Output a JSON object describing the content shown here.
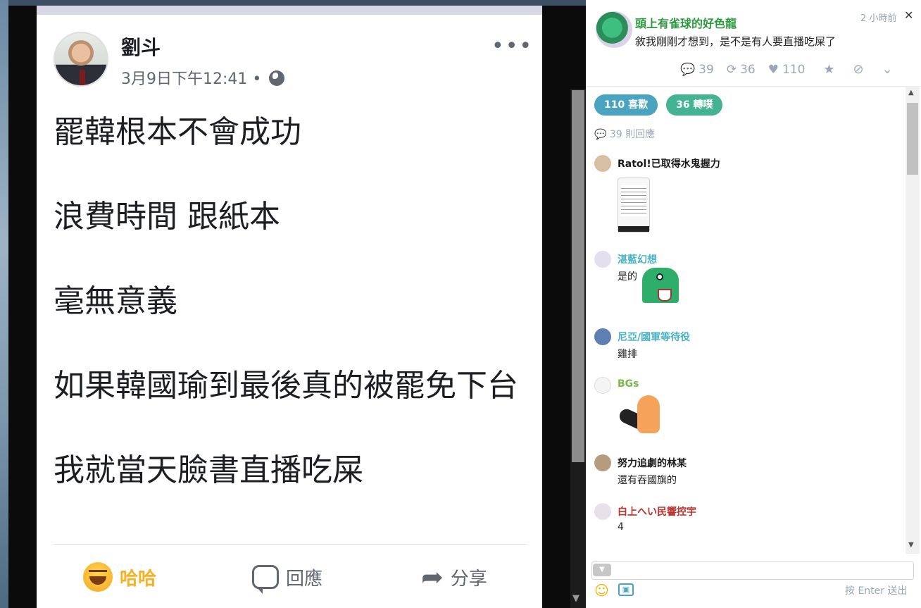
{
  "left_post": {
    "author": "劉斗",
    "timestamp": "3月9日下午12:41 •",
    "more_label": "•••",
    "body": [
      "罷韓根本不會成功",
      "浪費時間 跟紙本",
      "毫無意義",
      "如果韓國瑜到最後真的被罷免下台",
      "我就當天臉書直播吃屎"
    ],
    "actions": {
      "haha": "哈哈",
      "comment": "回應",
      "share": "分享"
    }
  },
  "plurk": {
    "author": "頭上有雀球的好色龍",
    "time": "2 小時前",
    "content": "敘我剛剛才想到，是不是有人要直播吃屎了",
    "stats": {
      "responses": "39",
      "replurks": "36",
      "likes": "110"
    },
    "badges": {
      "likes": "110 喜歡",
      "replurks": "36 轉噗"
    },
    "response_count": "39 則回應",
    "responses": [
      {
        "name": "Ratol!已取得水鬼握力",
        "text": "",
        "color": "#1a1a1a"
      },
      {
        "name": "湛藍幻想",
        "text": "是的",
        "color": "#4bb3c4"
      },
      {
        "name": "尼亞/國軍等待役",
        "text": "雞排",
        "color": "#4bb3c4"
      },
      {
        "name": "BGs",
        "text": "",
        "color": "#7ab84a"
      },
      {
        "name": "努力追劇的林某",
        "text": "還有吞國旗的",
        "color": "#1a1a1a"
      },
      {
        "name": "白上へい民響控宇",
        "text": "4",
        "color": "#b8322e"
      }
    ],
    "input_hint": "按 Enter 送出",
    "colors": {
      "author": "#2b9a3e",
      "like_badge": "#4aa3bf",
      "replurk_badge": "#44b391"
    }
  }
}
